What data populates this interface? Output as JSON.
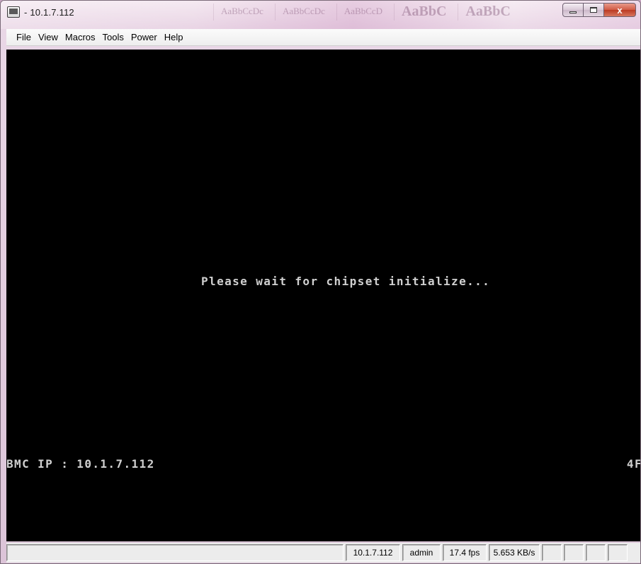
{
  "window": {
    "title": "- 10.1.7.112",
    "icon": "app-window-icon",
    "controls": {
      "minimize_icon": "minimize-icon",
      "maximize_icon": "maximize-icon",
      "close_label": "x"
    },
    "background_tabs": [
      "AaBbCcDc",
      "AaBbCcDc",
      "AaBbCcD",
      "AaBbC",
      "AaBbC"
    ]
  },
  "menu": {
    "items": [
      "File",
      "View",
      "Macros",
      "Tools",
      "Power",
      "Help"
    ]
  },
  "console": {
    "message": "Please wait for chipset initialize...",
    "bmc_ip_line": "BMC IP : 10.1.7.112",
    "post_code": "4F",
    "background_color": "#000000",
    "text_color": "#d0d0d0"
  },
  "status": {
    "message": "",
    "host": "10.1.7.112",
    "user": "admin",
    "fps": "17.4 fps",
    "rate": "5.653 KB/s",
    "indicators": [
      "",
      "",
      "",
      ""
    ]
  }
}
